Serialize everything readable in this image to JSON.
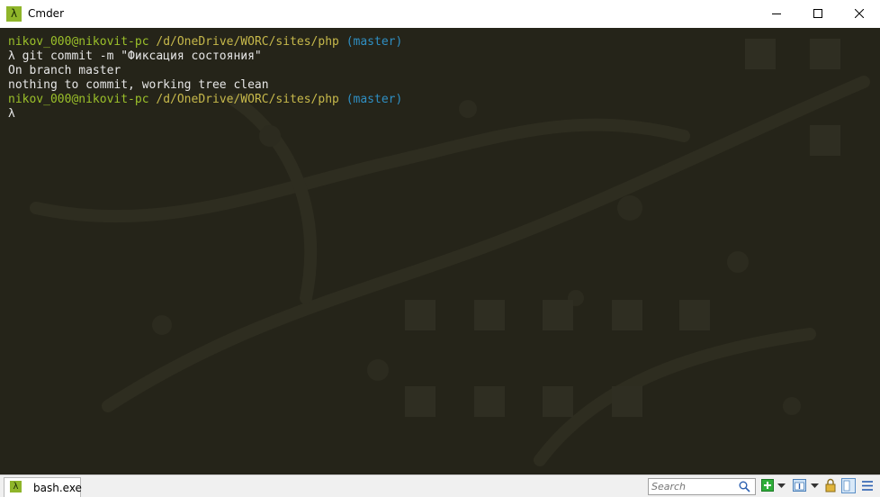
{
  "window": {
    "title": "Cmder"
  },
  "console": {
    "lines": [
      [
        {
          "t": "nikov_000@nikovit-pc",
          "c": "green"
        },
        {
          "t": " ",
          "c": "white"
        },
        {
          "t": "/d/OneDrive/WORC/sites/php",
          "c": "yellow"
        },
        {
          "t": " ",
          "c": "white"
        },
        {
          "t": "(master)",
          "c": "blue"
        }
      ],
      [
        {
          "t": "λ git commit -m \"Фиксация состояния\"",
          "c": "white"
        }
      ],
      [
        {
          "t": "On branch master",
          "c": "white"
        }
      ],
      [
        {
          "t": "nothing to commit, working tree clean",
          "c": "white"
        }
      ],
      [
        {
          "t": "nikov_000@nikovit-pc",
          "c": "green"
        },
        {
          "t": " ",
          "c": "white"
        },
        {
          "t": "/d/OneDrive/WORC/sites/php",
          "c": "yellow"
        },
        {
          "t": " ",
          "c": "white"
        },
        {
          "t": "(master)",
          "c": "blue"
        }
      ],
      [
        {
          "t": "λ",
          "c": "white"
        }
      ]
    ]
  },
  "statusbar": {
    "tab_label": "bash.exe",
    "search_placeholder": "Search"
  },
  "icons": {
    "app": "lambda-icon",
    "tab": "lambda-icon",
    "minimize": "minimize-icon",
    "maximize": "maximize-icon",
    "close": "close-icon",
    "search": "search-icon",
    "new_console": "plus-icon",
    "view": "layout-icon",
    "lock": "lock-icon",
    "split": "split-view-icon",
    "menu": "hamburger-icon"
  },
  "colors": {
    "console_bg": "#252419",
    "prompt_user": "#9bc02a",
    "prompt_path": "#c7b94b",
    "prompt_branch": "#2f8fc3",
    "text": "#e6e6e6",
    "accent": "#8fb52a"
  }
}
